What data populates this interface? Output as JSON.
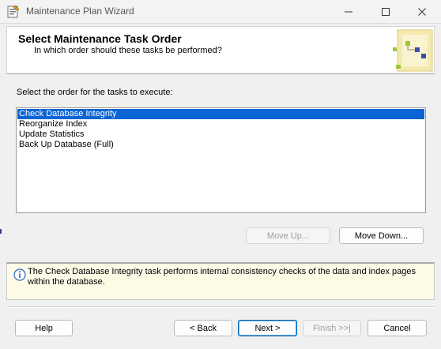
{
  "window": {
    "title": "Maintenance Plan Wizard",
    "controls": {
      "minimize": "minimize-icon",
      "maximize": "maximize-icon",
      "close": "close-icon"
    }
  },
  "header": {
    "title": "Select Maintenance Task Order",
    "subtitle": "In which order should these tasks be performed?"
  },
  "tasks": {
    "prompt": "Select the order for the tasks to execute:",
    "items": [
      "Check Database Integrity",
      "Reorganize Index",
      "Update Statistics",
      "Back Up Database (Full)"
    ],
    "selected_index": 0
  },
  "order_buttons": {
    "move_up": "Move Up...",
    "move_down": "Move Down..."
  },
  "info": {
    "icon": "info-icon",
    "text": "The Check Database Integrity task performs internal consistency checks of the data and index pages within the database."
  },
  "footer": {
    "help": "Help",
    "back": "< Back",
    "next": "Next >",
    "finish": "Finish >>|",
    "cancel": "Cancel"
  },
  "colors": {
    "selection": "#0a64d4",
    "info_background": "#fdfbe6",
    "accent": "#0067c0"
  }
}
